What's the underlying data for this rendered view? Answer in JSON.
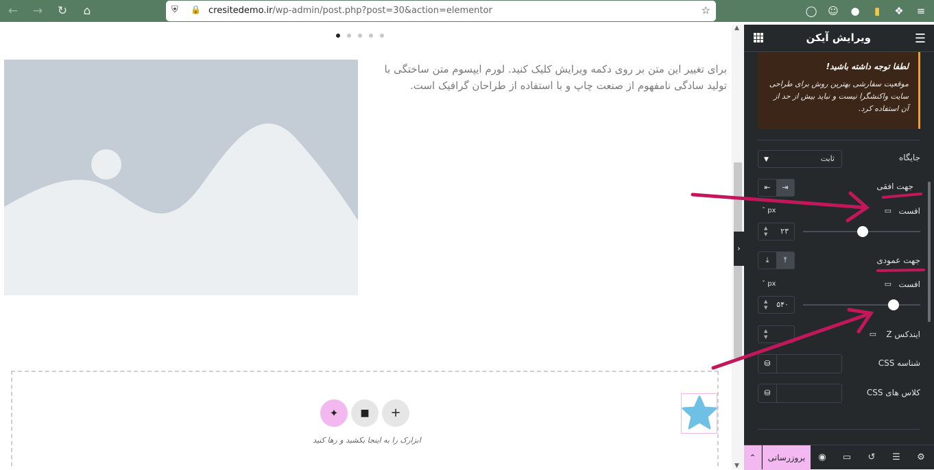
{
  "browser": {
    "url_domain": "cresitedemo.ir",
    "url_path": "/wp-admin/post.php?post=30&action=elementor"
  },
  "canvas": {
    "paragraph": "برای تغییر این متن بر روی دکمه ویرایش کلیک کنید. لورم ایپسوم متن ساختگی با تولید سادگی نامفهوم از صنعت چاپ و با استفاده از طراحان گرافیک است.",
    "drop_hint": "ابزارک را به اینجا بکشید و رها کنید"
  },
  "panel": {
    "title": "ویرایش آیکن",
    "notice_title": "لطفا توجه داشته باشید!",
    "notice_body": "موقعیت سفارشی بهترین روش برای طراحی سایت واکنشگرا نیست و نباید بیش از حد از آن استفاده کرد.",
    "position_label": "جایگاه",
    "position_value": "ثابت",
    "horizontal_label": "جهت افقی",
    "offset_label": "افست",
    "unit": "px",
    "h_offset_value": "۲۳",
    "h_slider_percent": 51,
    "vertical_label": "جهت عمودی",
    "v_offset_value": "۵۴۰",
    "v_slider_percent": 77,
    "z_index_label": "ایندکس Z",
    "css_id_label": "شناسه CSS",
    "css_class_label": "کلاس های CSS"
  },
  "footer": {
    "update_label": "بروزرسانی"
  },
  "colors": {
    "browser": "#567d62",
    "panel_bg": "#26292c",
    "accent_pink": "#f3b8ef",
    "notice_border": "#f0a12a",
    "annotation": "#c2185b",
    "star": "#6ec1e4"
  }
}
